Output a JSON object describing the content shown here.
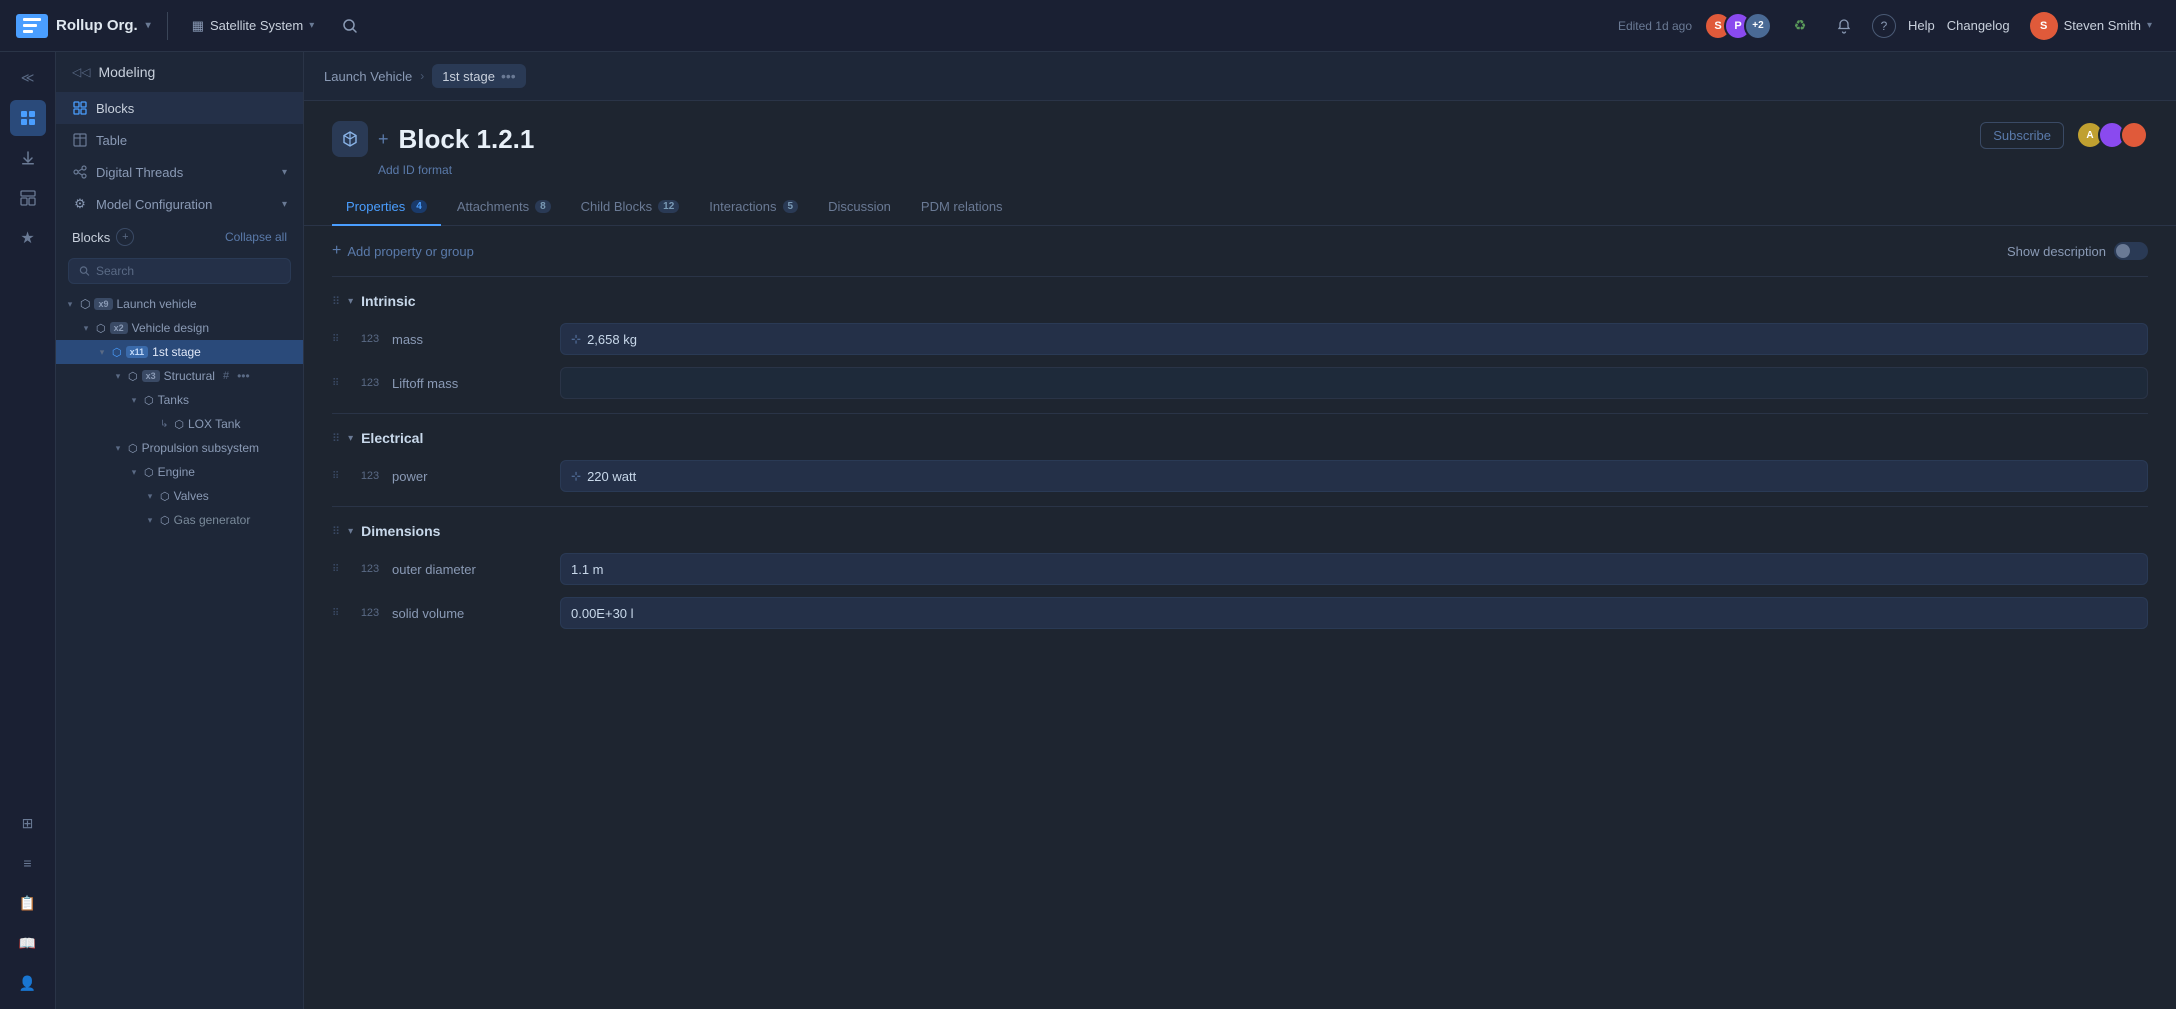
{
  "app": {
    "logo_text": "Rollup Org.",
    "workspace": "Satellite System",
    "edited": "Edited 1d ago",
    "help": "Help",
    "changelog": "Changelog",
    "user": "Steven Smith",
    "avatars": [
      {
        "initials": "S",
        "color": "#e05a3a"
      },
      {
        "initials": "P",
        "color": "#8a4aef"
      },
      {
        "initials": "+2",
        "color": "#4a6a95"
      }
    ]
  },
  "sidebar": {
    "header": "Modeling",
    "nav_items": [
      {
        "label": "Blocks",
        "icon": "⊞",
        "active": true
      },
      {
        "label": "Table",
        "icon": "▦"
      },
      {
        "label": "Digital Threads",
        "icon": "⊹",
        "has_chevron": true
      },
      {
        "label": "Model Configuration",
        "icon": "⚙",
        "has_chevron": true
      }
    ],
    "blocks_section": {
      "title": "Blocks",
      "collapse_all": "Collapse all",
      "search_placeholder": "Search"
    },
    "tree": [
      {
        "indent": 0,
        "icon": "⬡",
        "badge": "x9",
        "label": "Launch vehicle",
        "expanded": true,
        "children": [
          {
            "indent": 1,
            "icon": "⬡",
            "badge": "x2",
            "label": "Vehicle design",
            "expanded": true,
            "children": [
              {
                "indent": 2,
                "icon": "⬡",
                "badge": "x11",
                "label": "1st stage",
                "selected": true,
                "expanded": true,
                "children": [
                  {
                    "indent": 3,
                    "icon": "⬡",
                    "badge": "x3",
                    "label": "Structural",
                    "has_hash": true,
                    "has_dots": true,
                    "expanded": true,
                    "children": [
                      {
                        "indent": 4,
                        "icon": "⬡",
                        "label": "Tanks",
                        "expanded": true,
                        "children": [
                          {
                            "indent": 5,
                            "icon": "⬡",
                            "label": "LOX Tank"
                          }
                        ]
                      }
                    ]
                  },
                  {
                    "indent": 3,
                    "icon": "⬡",
                    "label": "Propulsion subsystem",
                    "expanded": true,
                    "children": [
                      {
                        "indent": 4,
                        "icon": "⬡",
                        "label": "Engine",
                        "expanded": true,
                        "children": [
                          {
                            "indent": 5,
                            "icon": "⬡",
                            "label": "Valves"
                          },
                          {
                            "indent": 5,
                            "icon": "⬡",
                            "label": "Gas generator"
                          }
                        ]
                      }
                    ]
                  }
                ]
              }
            ]
          }
        ]
      }
    ]
  },
  "breadcrumb": {
    "parent": "Launch Vehicle",
    "current": "1st stage"
  },
  "block": {
    "title": "Block 1.2.1",
    "add_id_format": "Add ID format",
    "subscribe": "Subscribe",
    "tabs": [
      {
        "label": "Properties",
        "badge": "4",
        "active": true
      },
      {
        "label": "Attachments",
        "badge": "8"
      },
      {
        "label": "Child Blocks",
        "badge": "12"
      },
      {
        "label": "Interactions",
        "badge": "5"
      },
      {
        "label": "Discussion",
        "badge": ""
      },
      {
        "label": "PDM relations",
        "badge": ""
      }
    ],
    "add_property_label": "Add property or group",
    "show_description": "Show description",
    "properties": [
      {
        "group": "Intrinsic",
        "items": [
          {
            "type": "123",
            "name": "mass",
            "value": "2,658 kg",
            "has_value": true
          },
          {
            "type": "123",
            "name": "Liftoff mass",
            "value": "",
            "has_value": false
          }
        ]
      },
      {
        "group": "Electrical",
        "items": [
          {
            "type": "123",
            "name": "power",
            "value": "220 watt",
            "has_value": true
          }
        ]
      },
      {
        "group": "Dimensions",
        "items": [
          {
            "type": "123",
            "name": "outer diameter",
            "value": "1.1 m",
            "has_value": true
          },
          {
            "type": "123",
            "name": "solid volume",
            "value": "0.00E+30 l",
            "has_value": true
          }
        ]
      }
    ]
  }
}
